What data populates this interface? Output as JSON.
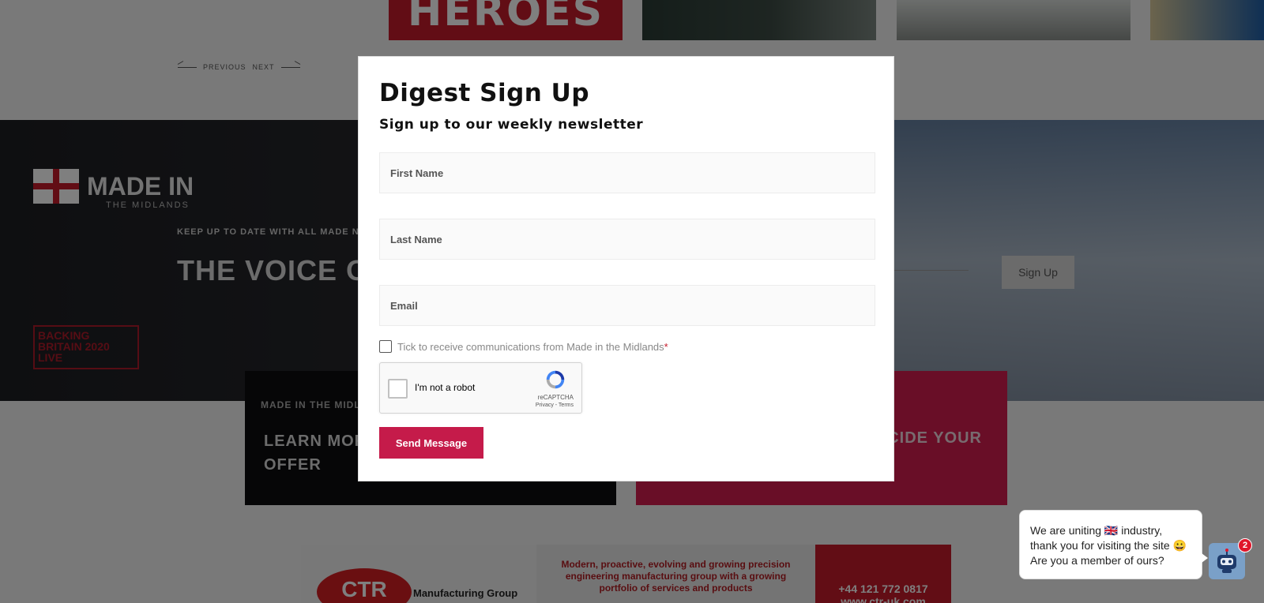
{
  "background": {
    "thumb1_text": "HEROES",
    "pager": {
      "previous": "PREVIOUS",
      "next": "NEXT"
    },
    "hero": {
      "logo_text": "MADE IN",
      "logo_sub": "THE MIDLANDS",
      "kicker": "KEEP UP TO DATE WITH ALL MADE NI",
      "title": "THE VOICE O",
      "signup_button": "Sign Up",
      "backing_badge": "BACKING BRITAIN 2020 LIVE"
    },
    "card_dark": {
      "kicker": "MADE IN THE MIDLA",
      "title": "LEARN MOR\nOFFER"
    },
    "card_pink": {
      "title": "CIDE YOUR"
    },
    "ad": {
      "logo": "CTR",
      "company": "Manufacturing Group",
      "text": "Modern, proactive, evolving and growing precision engineering manufacturing group with a growing portfolio of services and products",
      "phone": "+44 121 772 0817",
      "web": "www.ctr-uk.com"
    }
  },
  "modal": {
    "title": "Digest Sign Up",
    "subtitle": "Sign up to our weekly newsletter",
    "fields": {
      "first_name": "First Name",
      "last_name": "Last Name",
      "email": "Email"
    },
    "consent_label": "Tick to receive communications from Made in the Midlands",
    "consent_required_mark": "*",
    "captcha": {
      "label": "I'm not a robot",
      "brand": "reCAPTCHA",
      "terms": "Privacy - Terms"
    },
    "submit_label": "Send Message"
  },
  "chat": {
    "message": "We are uniting 🇬🇧 industry, thank you for visiting the site 😀Are you a member of ours?",
    "badge_count": "2"
  },
  "colors": {
    "brand_red": "#c51b4a",
    "overlay": "rgba(0,0,0,0.5)"
  }
}
